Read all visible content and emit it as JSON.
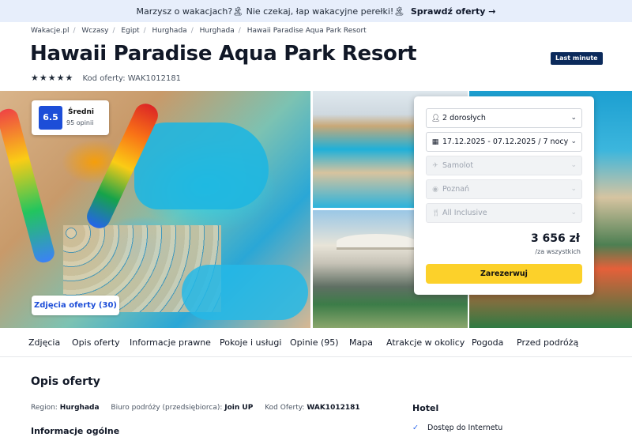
{
  "banner": {
    "text": "Marzysz o wakacjach?🏝 Nie czekaj, łap wakacyjne perełki!🏝",
    "link": "Sprawdź oferty →"
  },
  "breadcrumb": [
    "Wakacje.pl",
    "Wczasy",
    "Egipt",
    "Hurghada",
    "Hurghada",
    "Hawaii Paradise Aqua Park Resort"
  ],
  "hotel": {
    "title": "Hawaii Paradise Aqua Park Resort",
    "badge": "Last minute",
    "stars": "★★★★★",
    "stars_count": 5,
    "offer_code_label": "Kod oferty: WAK1012181"
  },
  "rating": {
    "score": "6.5",
    "label": "Średni",
    "count": "95 opinii"
  },
  "gallery": {
    "photos_button": "Zdjęcia oferty (30)"
  },
  "booking": {
    "travelers": "2 dorosłych",
    "dates": "17.12.2025 - 07.12.2025 / 7 nocy",
    "transport": "Samolot",
    "departure": "Poznań",
    "board": "All Inclusive",
    "price": "3 656 zł",
    "price_note": "/za wszystkich",
    "reserve_button": "Zarezerwuj"
  },
  "tabs": [
    "Zdjęcia",
    "Opis oferty",
    "Informacje prawne",
    "Pokoje i usługi",
    "Opinie (95)",
    "Mapa",
    "Atrakcje w okolicy",
    "Pogoda",
    "Przed podróżą"
  ],
  "description": {
    "title": "Opis oferty",
    "region_label": "Region:",
    "region_value": "Hurghada",
    "agency_label": "Biuro podróży (przedsiębiorca):",
    "agency_value": "Join UP",
    "code_label": "Kod Oferty:",
    "code_value": "WAK1012181",
    "general_info_title": "Informacje ogólne"
  },
  "hotel_panel": {
    "title": "Hotel",
    "amenities": [
      "Dostęp do Internetu"
    ]
  }
}
